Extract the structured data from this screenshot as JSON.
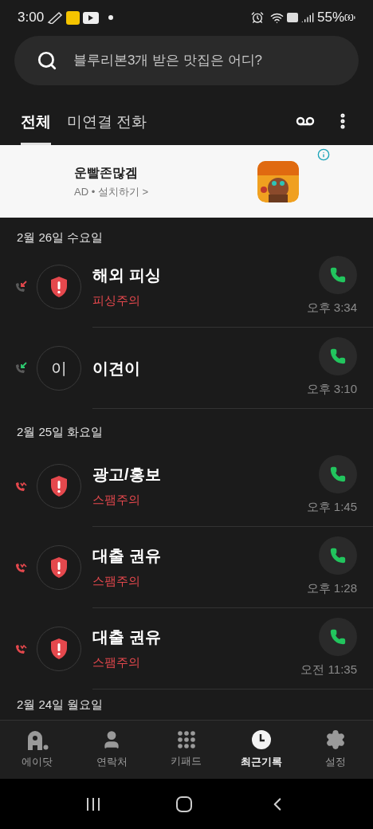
{
  "status_bar": {
    "time": "3:00",
    "battery": "55%"
  },
  "search": {
    "placeholder": "블루리본3개 받은 맛집은 어디?"
  },
  "tabs": [
    {
      "label": "전체",
      "selected": true
    },
    {
      "label": "미연결 전화",
      "selected": false
    }
  ],
  "ad": {
    "title": "운빨존많겜",
    "subtitle": "AD • 설치하기 >"
  },
  "groups": [
    {
      "date": "2월 26일 수요일",
      "calls": [
        {
          "name": "해외 피싱",
          "warning": "피싱주의",
          "time": "오후 3:34",
          "call": {
            "kind": "missed"
          },
          "avatar": {
            "kind": "alert"
          }
        },
        {
          "name": "이견이",
          "time": "오후 3:10",
          "call": {
            "kind": "incoming"
          },
          "avatar": {
            "kind": "initial",
            "text": "이"
          }
        }
      ]
    },
    {
      "date": "2월 25일 화요일",
      "calls": [
        {
          "name": "광고/홍보",
          "warning": "스팸주의",
          "time": "오후 1:45",
          "call": {
            "kind": "declined"
          },
          "avatar": {
            "kind": "alert"
          }
        },
        {
          "name": "대출 권유",
          "warning": "스팸주의",
          "time": "오후 1:28",
          "call": {
            "kind": "declined"
          },
          "avatar": {
            "kind": "alert"
          }
        },
        {
          "name": "대출 권유",
          "warning": "스팸주의",
          "time": "오전 11:35",
          "call": {
            "kind": "declined"
          },
          "avatar": {
            "kind": "alert"
          }
        }
      ]
    },
    {
      "date": "2월 24일 월요일"
    }
  ],
  "nav": [
    {
      "label": "에이닷",
      "kind": "adot",
      "selected": false
    },
    {
      "label": "연락처",
      "kind": "contacts",
      "selected": false
    },
    {
      "label": "키패드",
      "kind": "keypad",
      "selected": false
    },
    {
      "label": "최근기록",
      "kind": "recent",
      "selected": true
    },
    {
      "label": "설정",
      "kind": "settings",
      "selected": false
    }
  ]
}
